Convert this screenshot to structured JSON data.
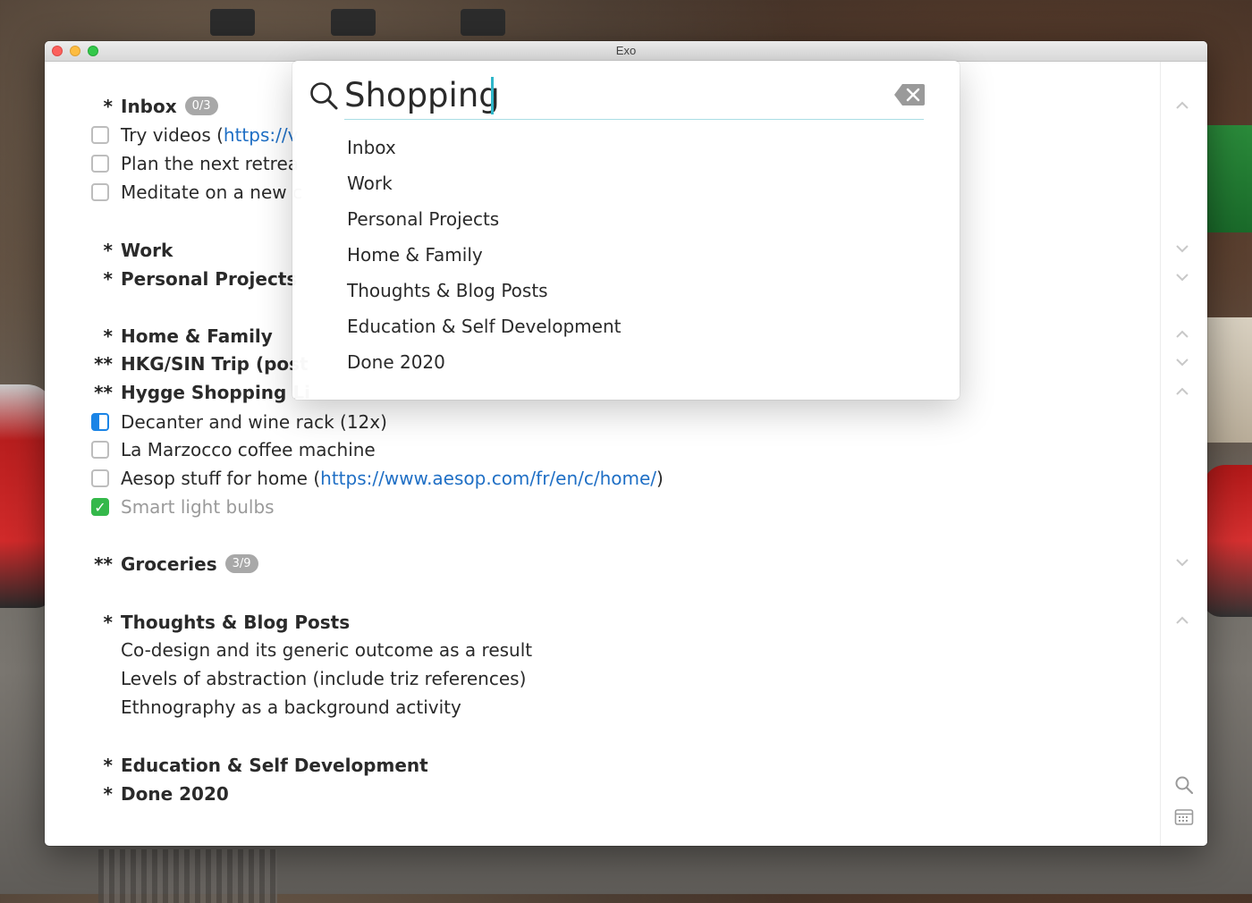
{
  "window": {
    "title": "Exo"
  },
  "outline": {
    "inbox": {
      "marker": "*",
      "label": "Inbox",
      "badge": "0/3"
    },
    "inbox_items": [
      {
        "text": "Try videos (",
        "link": "https://v"
      },
      {
        "text": "Plan the next retrea"
      },
      {
        "text": "Meditate on a new c"
      }
    ],
    "work": {
      "marker": "*",
      "label": "Work"
    },
    "personal": {
      "marker": "*",
      "label": "Personal Projects"
    },
    "home": {
      "marker": "*",
      "label": "Home & Family"
    },
    "hkg": {
      "marker": "**",
      "label": "HKG/SIN Trip (post"
    },
    "hygge": {
      "marker": "**",
      "label": "Hygge Shopping Li"
    },
    "hygge_items": [
      {
        "text": "Decanter and wine rack (12x)",
        "state": "in-progress"
      },
      {
        "text": "La Marzocco coffee machine",
        "state": "open"
      },
      {
        "text": "Aesop stuff for home (",
        "link": "https://www.aesop.com/fr/en/c/home/",
        "suffix": ")",
        "state": "open"
      },
      {
        "text": "Smart light bulbs",
        "state": "done"
      }
    ],
    "groceries": {
      "marker": "**",
      "label": "Groceries",
      "badge": "3/9"
    },
    "thoughts": {
      "marker": "*",
      "label": "Thoughts & Blog Posts"
    },
    "thoughts_items": [
      "Co-design and its generic outcome as a result",
      "Levels of abstraction (include triz references)",
      "Ethnography as a background activity"
    ],
    "education": {
      "marker": "*",
      "label": "Education & Self Development"
    },
    "done2020": {
      "marker": "*",
      "label": "Done 2020"
    }
  },
  "search": {
    "query": "Shopping",
    "results": [
      "Inbox",
      "Work",
      "Personal Projects",
      "Home & Family",
      "Thoughts & Blog Posts",
      "Education & Self Development",
      "Done 2020"
    ]
  },
  "icons": {
    "search": "search-icon",
    "clear": "clear-icon",
    "calendar": "calendar-icon",
    "chevron_up": "chevron-up-icon",
    "chevron_down": "chevron-down-icon"
  },
  "colors": {
    "link": "#1f6fc5",
    "caret": "#2fb6c9",
    "done": "#34b84a",
    "progress": "#1a84e6"
  }
}
